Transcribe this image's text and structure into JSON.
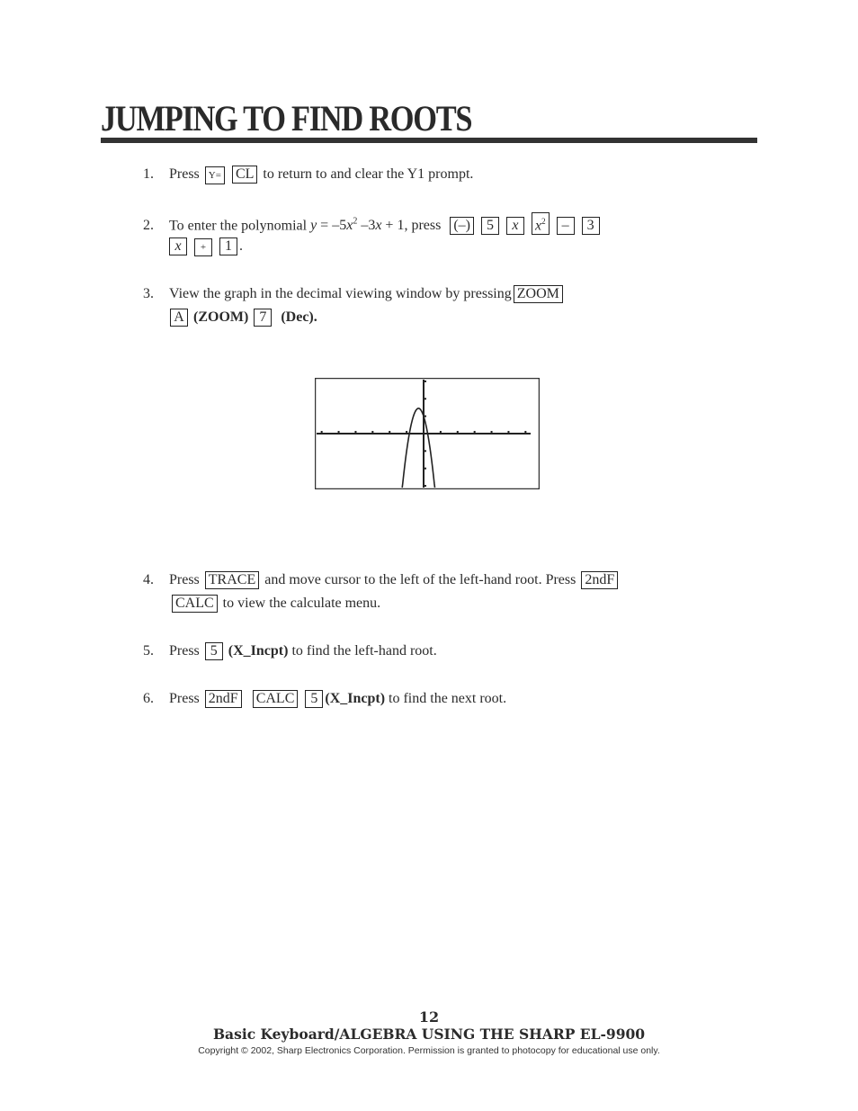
{
  "title": "JUMPING TO FIND ROOTS",
  "steps": {
    "s1": {
      "num": "1.",
      "pre": "Press",
      "keys": [
        "Y=",
        "CL"
      ],
      "post": "to return to and clear the Y1 prompt."
    },
    "s2": {
      "num": "2.",
      "pre": "To enter the polynomial",
      "eq_y": "y",
      "eq_mid": " = –5",
      "eq_x": "x",
      "eq_sup": "2",
      "eq_rest1": " –3",
      "eq_x2": "x",
      "eq_rest2": " + 1, press",
      "keys": [
        "(–)",
        "5",
        "x",
        "x",
        "–",
        "3",
        "x",
        "+",
        "1"
      ],
      "key_sup": "2",
      "post": "."
    },
    "s3": {
      "num": "3.",
      "pre": "View the graph in the decimal viewing window by pressing",
      "keys": [
        "ZOOM",
        "A",
        "7"
      ],
      "label1": "(ZOOM)",
      "label2": "(Dec)."
    },
    "s4": {
      "num": "4.",
      "pre": "Press",
      "keys": [
        "TRACE",
        "2ndF",
        "CALC"
      ],
      "mid": "and move cursor to the left of the left-hand root.  Press",
      "post": "to view the calculate menu."
    },
    "s5": {
      "num": "5.",
      "pre": "Press",
      "keys": [
        "5"
      ],
      "label": "(X_Incpt)",
      "post": "to find the left-hand root."
    },
    "s6": {
      "num": "6.",
      "pre": "Press",
      "keys": [
        "2ndF",
        "CALC",
        "5"
      ],
      "label": "(X_Incpt)",
      "post": "to find the next root."
    }
  },
  "chart_data": {
    "type": "line",
    "function": "y = -5x^2 - 3x + 1",
    "coefficients": {
      "a": -5,
      "b": -3,
      "c": 1
    },
    "xlim": [
      -6.3,
      6.3
    ],
    "ylim": [
      -3.1,
      3.1
    ],
    "xscl": 1,
    "yscl": 1,
    "title": "",
    "xlabel": "",
    "ylabel": ""
  },
  "footer": {
    "page_number": "12",
    "book_title": "Basic Keyboard/ALGEBRA USING THE SHARP EL-9900",
    "copyright": "Copyright © 2002, Sharp Electronics Corporation.  Permission is granted to photocopy for educational use only."
  }
}
